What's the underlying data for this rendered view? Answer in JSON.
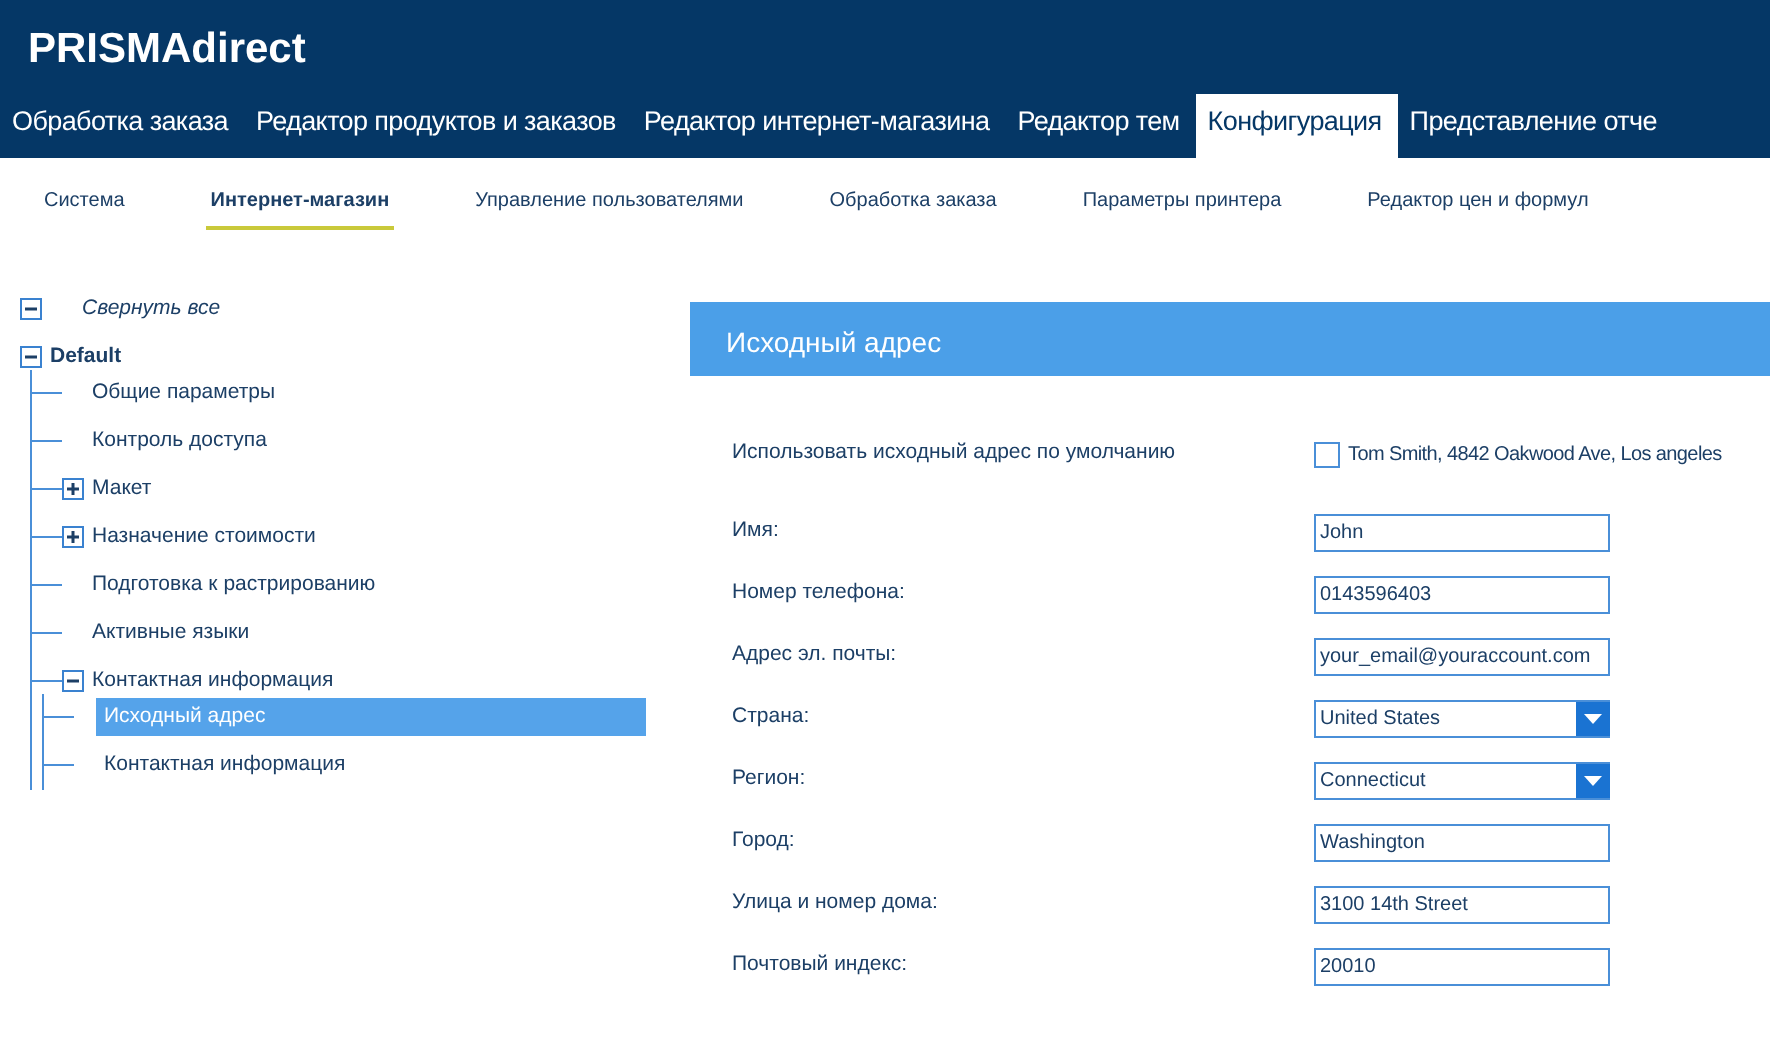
{
  "app_title": "PRISMAdirect",
  "main_tabs": [
    {
      "label": "Обработка заказа",
      "selected": false
    },
    {
      "label": "Редактор продуктов и заказов",
      "selected": false
    },
    {
      "label": "Редактор интернет-магазина",
      "selected": false
    },
    {
      "label": "Редактор тем",
      "selected": false
    },
    {
      "label": "Конфигурация",
      "selected": true
    },
    {
      "label": "Представление отче",
      "selected": false
    }
  ],
  "sub_tabs": [
    {
      "label": "Система",
      "selected": false
    },
    {
      "label": "Интернет-магазин",
      "selected": true
    },
    {
      "label": "Управление пользователями",
      "selected": false
    },
    {
      "label": "Обработка заказа",
      "selected": false
    },
    {
      "label": "Параметры принтера",
      "selected": false
    },
    {
      "label": "Редактор цен и формул",
      "selected": false
    }
  ],
  "tree": {
    "collapse_all": "Свернуть все",
    "root": {
      "label": "Default",
      "expanded": true,
      "children": [
        {
          "label": "Общие параметры",
          "selected": false
        },
        {
          "label": "Контроль доступа",
          "selected": false
        },
        {
          "label": "Макет",
          "selected": false,
          "expanded": false
        },
        {
          "label": "Назначение стоимости",
          "selected": false,
          "expanded": false
        },
        {
          "label": "Подготовка к растрированию",
          "selected": false
        },
        {
          "label": "Активные языки",
          "selected": false
        },
        {
          "label": "Контактная информация",
          "selected": false,
          "expanded": true,
          "children": [
            {
              "label": "Исходный адрес",
              "selected": true
            },
            {
              "label": "Контактная информация",
              "selected": false
            }
          ]
        }
      ]
    }
  },
  "panel": {
    "title": "Исходный адрес",
    "default_checkbox": {
      "label": "Использовать исходный адрес по умолчанию",
      "checked": false,
      "text": "Tom Smith, 4842 Oakwood Ave, Los angeles"
    },
    "fields": [
      {
        "kind": "text",
        "label": "Имя:",
        "value": "John"
      },
      {
        "kind": "text",
        "label": "Номер телефона:",
        "value": "0143596403"
      },
      {
        "kind": "text",
        "label": "Адрес эл. почты:",
        "value": "your_email@youraccount.com"
      },
      {
        "kind": "select",
        "label": "Страна:",
        "value": "United States"
      },
      {
        "kind": "select",
        "label": "Регион:",
        "value": "Connecticut"
      },
      {
        "kind": "text",
        "label": "Город:",
        "value": "Washington"
      },
      {
        "kind": "text",
        "label": "Улица и номер дома:",
        "value": "3100 14th Street"
      },
      {
        "kind": "text",
        "label": "Почтовый индекс:",
        "value": "20010"
      }
    ]
  }
}
